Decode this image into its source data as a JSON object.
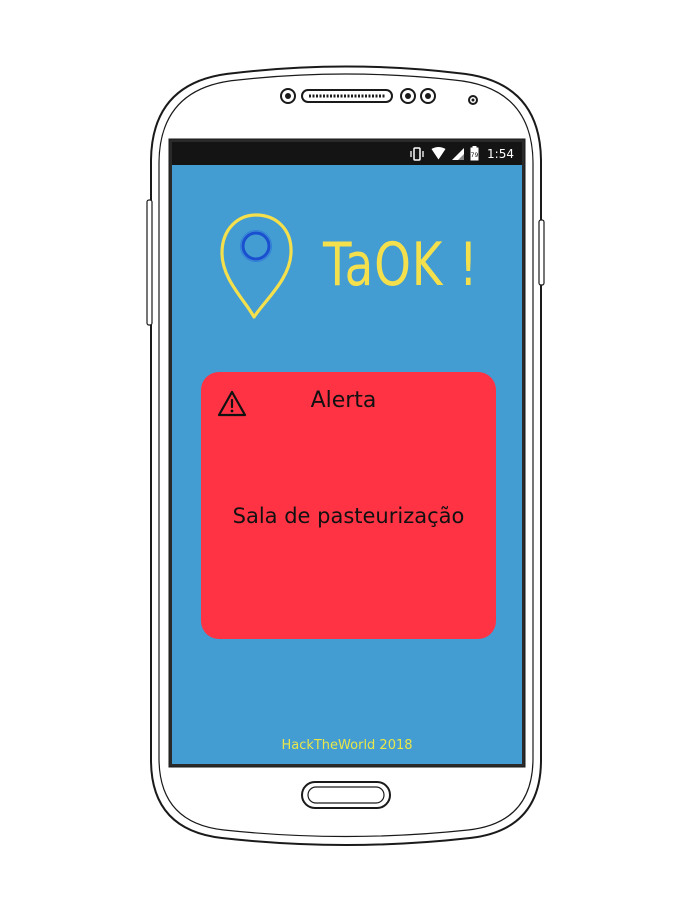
{
  "status_bar": {
    "time": "1:54",
    "icons": [
      "vibrate-icon",
      "wifi-icon",
      "signal-icon",
      "battery-icon"
    ]
  },
  "app": {
    "logo_text": "TaOK !"
  },
  "alert": {
    "icon": "warning-icon",
    "title": "Alerta",
    "message": "Sala de pasteurização"
  },
  "footer": {
    "text": "HackTheWorld 2018"
  },
  "colors": {
    "screen_background": "#439cd2",
    "alert_background": "#ff3344",
    "logo_yellow": "#f4e04d",
    "footer_text": "#e8e64a",
    "pin_ring": "#1a4fd0"
  }
}
